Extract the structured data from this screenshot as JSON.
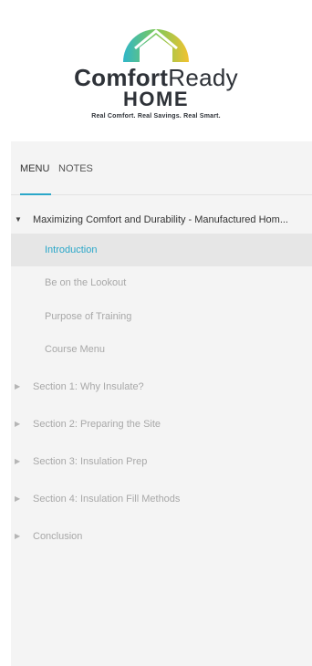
{
  "brand": {
    "name_bold": "Comfort",
    "name_light": "Ready",
    "name_second_line": "HOME",
    "tagline": "Real Comfort. Real Savings. Real Smart.",
    "logo_colors": [
      "#2fb6c9",
      "#7cc95a",
      "#f2c230"
    ]
  },
  "tabs": [
    {
      "label": "MENU",
      "active": true
    },
    {
      "label": "NOTES",
      "active": false
    }
  ],
  "accent_color": "#2aa7c9",
  "menu": {
    "course_title": "Maximizing Comfort and Durability - Manufactured Hom...",
    "course_expanded": true,
    "lessons": [
      {
        "label": "Introduction",
        "active": true
      },
      {
        "label": "Be on the Lookout",
        "active": false
      },
      {
        "label": "Purpose of Training",
        "active": false
      },
      {
        "label": "Course Menu",
        "active": false
      }
    ],
    "sections": [
      {
        "label": "Section 1: Why Insulate?"
      },
      {
        "label": "Section 2: Preparing the Site"
      },
      {
        "label": "Section 3: Insulation Prep"
      },
      {
        "label": "Section 4: Insulation Fill Methods"
      },
      {
        "label": "Conclusion"
      }
    ]
  },
  "icons": {
    "expanded": "caret-down-icon",
    "collapsed": "caret-right-icon"
  }
}
